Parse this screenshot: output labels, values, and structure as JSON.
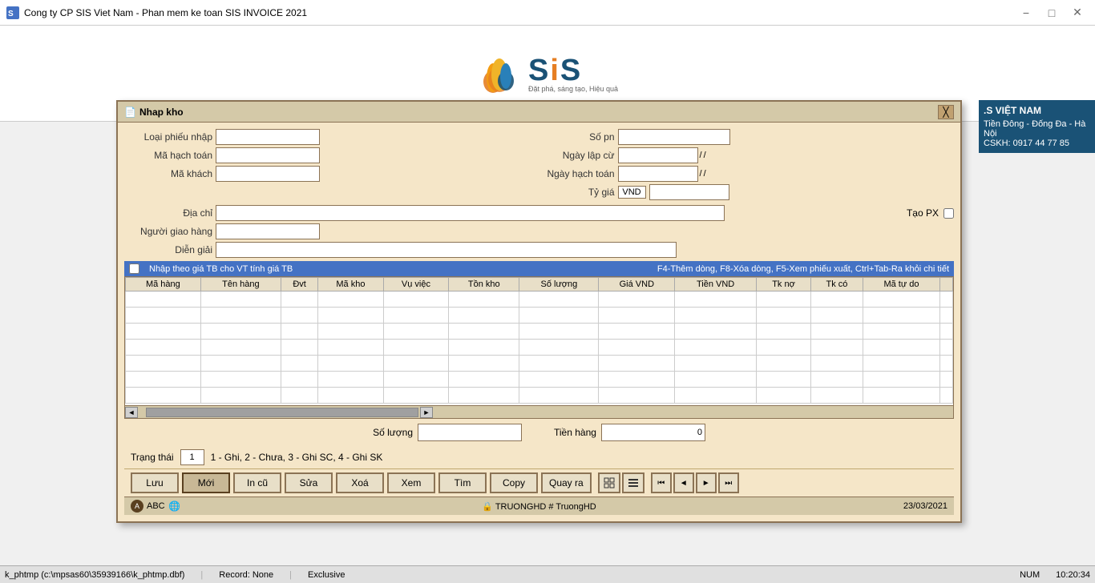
{
  "window": {
    "title": "Cong ty CP SIS Viet Nam - Phan mem ke toan SIS INVOICE 2021"
  },
  "logo": {
    "text": "SiS",
    "tagline": "Đặt phá, sáng tạo, Hiệu quả"
  },
  "dialog": {
    "title": "Nhap kho",
    "form": {
      "loai_phieu_nhap_label": "Loại phiếu nhập",
      "ma_hach_toan_label": "Mã hạch toán",
      "ma_khach_label": "Mã khách",
      "dia_chi_label": "Địa chỉ",
      "nguoi_giao_hang_label": "Người giao hàng",
      "dien_giai_label": "Diễn giải",
      "so_pn_label": "Số pn",
      "ngay_lap_cu_label": "Ngày lập cừ",
      "ngay_hach_toan_label": "Ngày hạch toán",
      "ty_gia_label": "Tỷ giá",
      "tao_px_label": "Tạo PX",
      "vnd_text": "VND",
      "date_sep1": "/",
      "date_sep2": "/"
    },
    "table_bar": {
      "checkbox_label": "Nhập theo giá TB cho VT tính giá TB",
      "hint": "F4-Thêm dòng, F8-Xóa dòng, F5-Xem phiếu xuất, Ctrl+Tab-Ra khỏi chi tiết"
    },
    "table": {
      "columns": [
        "Mã hàng",
        "Tên hàng",
        "Đvt",
        "Mã kho",
        "Vụ việc",
        "Tồn kho",
        "Số lượng",
        "Giá VND",
        "Tiền VND",
        "Tk nợ",
        "Tk có",
        "Mã tự do"
      ]
    },
    "summary": {
      "so_luong_label": "Số lượng",
      "tien_hang_label": "Tiền hàng",
      "tien_hang_value": "0"
    },
    "status": {
      "label": "Trạng thái",
      "value": "1",
      "desc": "1 - Ghi, 2 - Chưa, 3 - Ghi SC, 4 - Ghi SK"
    },
    "buttons": {
      "luu": "Lưu",
      "moi": "Mới",
      "in_cu": "In cũ",
      "sua": "Sửa",
      "xoa": "Xoá",
      "xem": "Xem",
      "tim": "Tìm",
      "copy": "Copy",
      "quay_ra": "Quay ra"
    },
    "bottom_bar": {
      "user_icon_text": "A",
      "company": "ABC",
      "globe_icon": "🌐",
      "user_info": "TRUONGHD # TruongHD",
      "date": "23/03/2021"
    }
  },
  "right_panel": {
    "title": ".S VIỆT NAM",
    "address": "Tiền Đông - Đống Đa - Hà Nội",
    "phone": "CSKH: 0917 44 77 85"
  },
  "app_status_bar": {
    "path": "k_phtmp (c:\\mpsas60\\35939166\\k_phtmp.dbf)",
    "record": "Record: None",
    "mode": "Exclusive",
    "num": "NUM",
    "time": "10:20:34"
  }
}
